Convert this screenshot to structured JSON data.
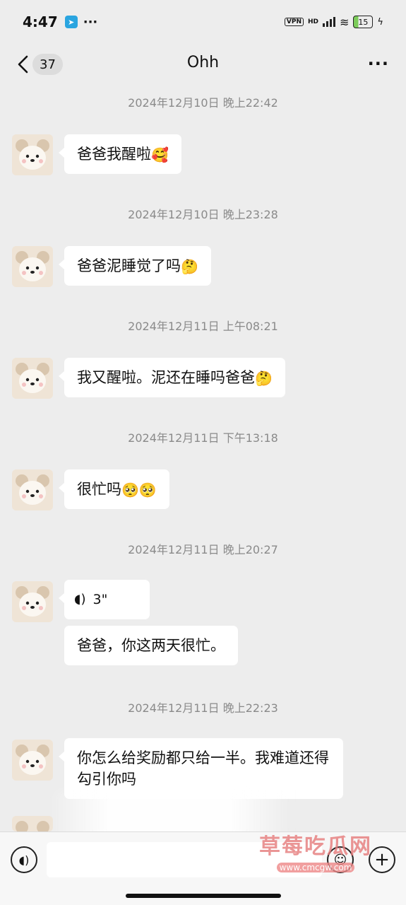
{
  "status_bar": {
    "time": "4:47",
    "more": "···",
    "vpn": "VPN",
    "hd": "HD",
    "battery": "15"
  },
  "header": {
    "unread_count": "37",
    "title": "Ohh"
  },
  "messages": [
    {
      "timestamp": "2024年12月10日 晚上22:42",
      "text": "爸爸我醒啦",
      "emoji": "🥰"
    },
    {
      "timestamp": "2024年12月10日 晚上23:28",
      "text": "爸爸泥睡觉了吗",
      "emoji": "🤔"
    },
    {
      "timestamp": "2024年12月11日 上午08:21",
      "text": "我又醒啦。泥还在睡吗爸爸",
      "emoji": "🤔"
    },
    {
      "timestamp": "2024年12月11日 下午13:18",
      "text": "很忙吗",
      "emoji": "🥺🥺"
    },
    {
      "timestamp": "2024年12月11日 晚上20:27",
      "voice_duration": "3\"",
      "text": "爸爸，你这两天很忙。"
    },
    {
      "timestamp": "2024年12月11日 晚上22:23",
      "text": "你怎么给奖励都只给一半。我难道还得勾引你吗"
    }
  ],
  "watermark": {
    "text": "草莓吃瓜网",
    "url": "www.cmcgw.com"
  }
}
